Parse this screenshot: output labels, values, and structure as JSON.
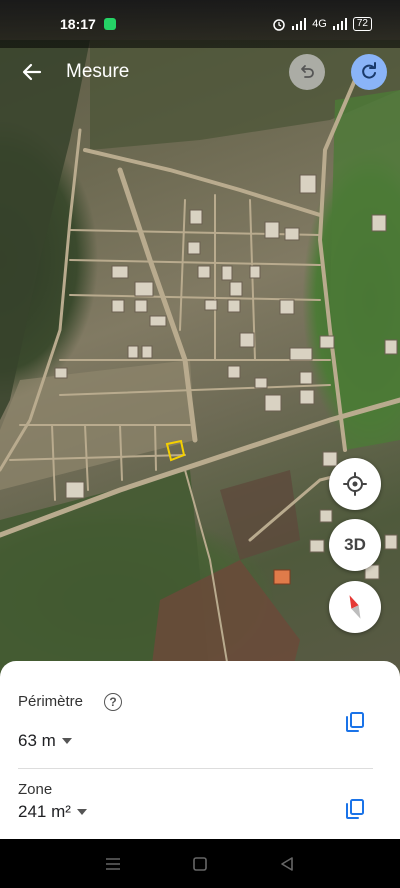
{
  "status_bar": {
    "time": "18:17",
    "network": "4G",
    "battery": "72"
  },
  "app_bar": {
    "title": "Mesure"
  },
  "map": {
    "fab_3d_label": "3D"
  },
  "measure": {
    "perimeter_label": "Périmètre",
    "perimeter_value": "63 m",
    "area_label": "Zone",
    "area_value": "241 m²"
  },
  "colors": {
    "accent": "#8ab4f8",
    "measure_polygon": "#f5d000",
    "icon_blue": "#1a73e8",
    "compass_red": "#e53935"
  }
}
